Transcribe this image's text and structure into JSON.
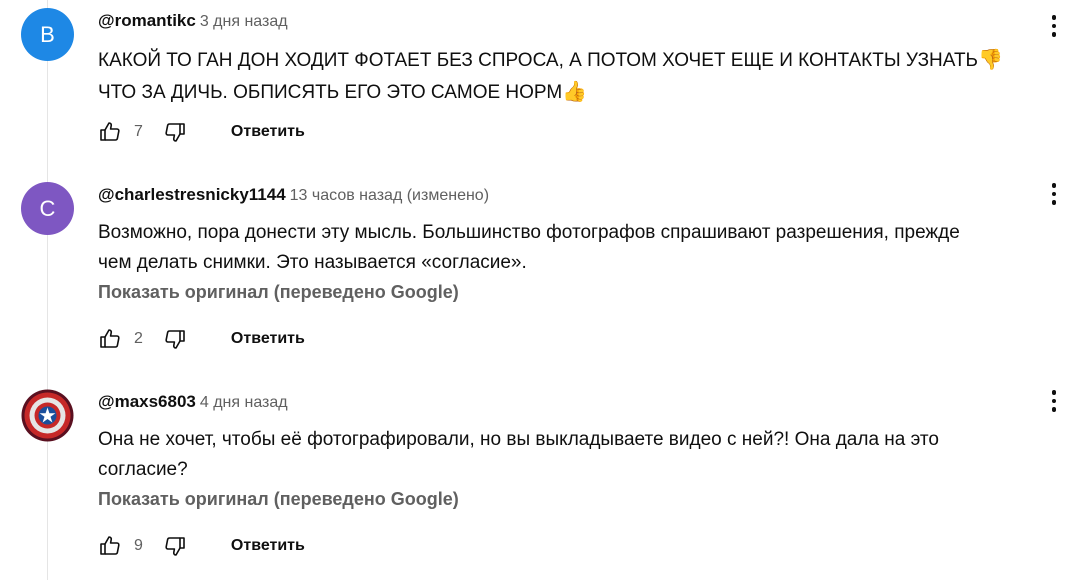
{
  "comments": [
    {
      "avatar_letter": "B",
      "avatar_color": "#1e88e5",
      "author": "@romantikc",
      "time": "3 дня назад",
      "text_line1": "КАКОЙ ТО ГАН ДОН ХОДИТ ФОТАЕТ БЕЗ СПРОСА, А ПОТОМ ХОЧЕТ ЕЩЕ И КОНТАКТЫ УЗНАТЬ",
      "emoji1": "👎",
      "text_line2": "ЧТО ЗА ДИЧЬ. ОБПИСЯТЬ ЕГО ЭТО САМОЕ НОРМ",
      "emoji2": "👍",
      "likes": "7",
      "reply_label": "Ответить"
    },
    {
      "avatar_letter": "C",
      "avatar_color": "#7e57c2",
      "author": "@charlestresnicky1144",
      "time": "13 часов назад (изменено)",
      "text": "Возможно, пора донести эту мысль. Большинство фотографов спрашивают разрешения, прежде\nчем делать снимки. Это называется «согласие».",
      "translate_label": "Показать оригинал (переведено Google)",
      "likes": "2",
      "reply_label": "Ответить"
    },
    {
      "avatar_icon": "captain-shield-icon",
      "author": "@maxs6803",
      "time": "4 дня назад",
      "text": "Она не хочет, чтобы её фотографировали, но вы выкладываете видео с ней?! Она дала на это\nсогласие?",
      "translate_label": "Показать оригинал (переведено Google)",
      "likes": "9",
      "reply_label": "Ответить"
    }
  ]
}
